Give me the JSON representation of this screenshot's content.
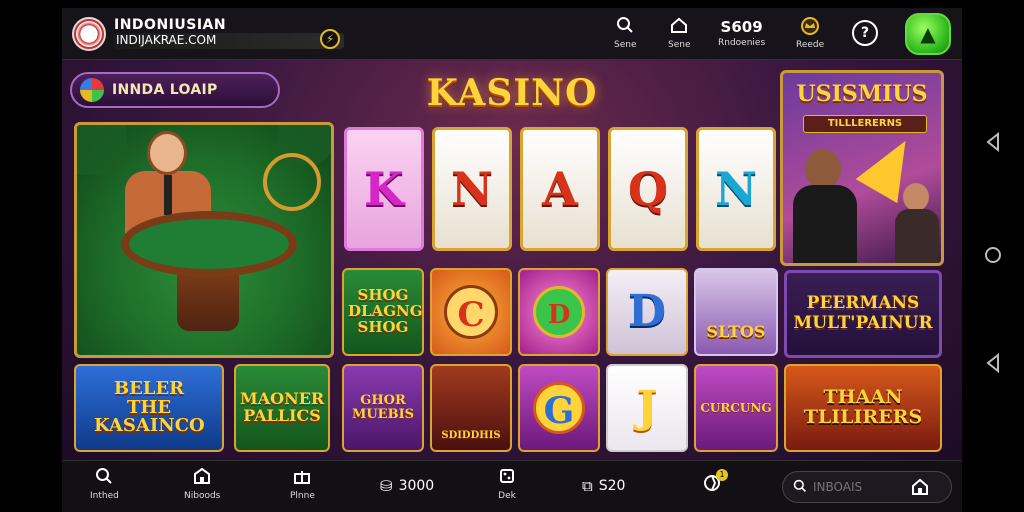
{
  "header": {
    "site_name": "INDONIUSIAN",
    "site_url": "INDIJAKRAE.COM",
    "items": [
      {
        "label": "Sene",
        "icon": "search-icon"
      },
      {
        "label": "Sene",
        "icon": "home-icon"
      },
      {
        "label": "Rndoenies",
        "value": "S609"
      },
      {
        "label": "Reede",
        "icon": "crown-icon"
      }
    ],
    "help_icon": "help-search-icon",
    "cta_icon": "vip-badge-icon"
  },
  "main": {
    "jackpot_label": "INNDA LOAIP",
    "title": "KASINO",
    "reels": [
      "K",
      "N",
      "A",
      "Q",
      "N"
    ],
    "reel_colors": [
      "#d526c7",
      "#d6331a",
      "#d6331a",
      "#d6331a",
      "#1aa7d6"
    ],
    "tiles": [
      {
        "text": "SHOG DLAGNG SHOG",
        "color": "#ffd43a"
      },
      {
        "text": "C",
        "color": "#d6331a"
      },
      {
        "text": "D",
        "color": "#d6331a"
      },
      {
        "text": "D",
        "color": "#2e6fd6"
      },
      {
        "text": "SLTOS",
        "color": "#ffd43a"
      },
      {
        "text": "BELER THE KASAINCO",
        "color": "#ffd43a"
      },
      {
        "text": "MAONER PALLICS",
        "color": "#ffd43a"
      },
      {
        "text": "GHOR MUEBIS",
        "color": "#ffd43a"
      },
      {
        "text": "SDIDDHIS",
        "color": "#ffd43a"
      },
      {
        "text": "G",
        "color": "#2e6fd6"
      },
      {
        "text": "J",
        "color": "#ffd43a"
      },
      {
        "text": "CURCUNG",
        "color": "#ffd43a"
      },
      {
        "text": "THAAN TLILIRERS",
        "color": "#ffd43a"
      }
    ],
    "promo_title": "USISMIUS",
    "promo_subtitle": "TILLLERERNS",
    "multiplayer_label": "PEERMANS MULT'PAINUR"
  },
  "footer": {
    "items": [
      {
        "label": "Inthed",
        "icon": "search-icon"
      },
      {
        "label": "Niboods",
        "icon": "store-icon"
      },
      {
        "label": "Plnne",
        "icon": "gift-icon"
      },
      {
        "label": "Dek",
        "icon": "dice-icon"
      }
    ],
    "amounts": [
      "3000",
      "S20"
    ],
    "badge_count": "1",
    "search_placeholder": "INBOAIS"
  }
}
